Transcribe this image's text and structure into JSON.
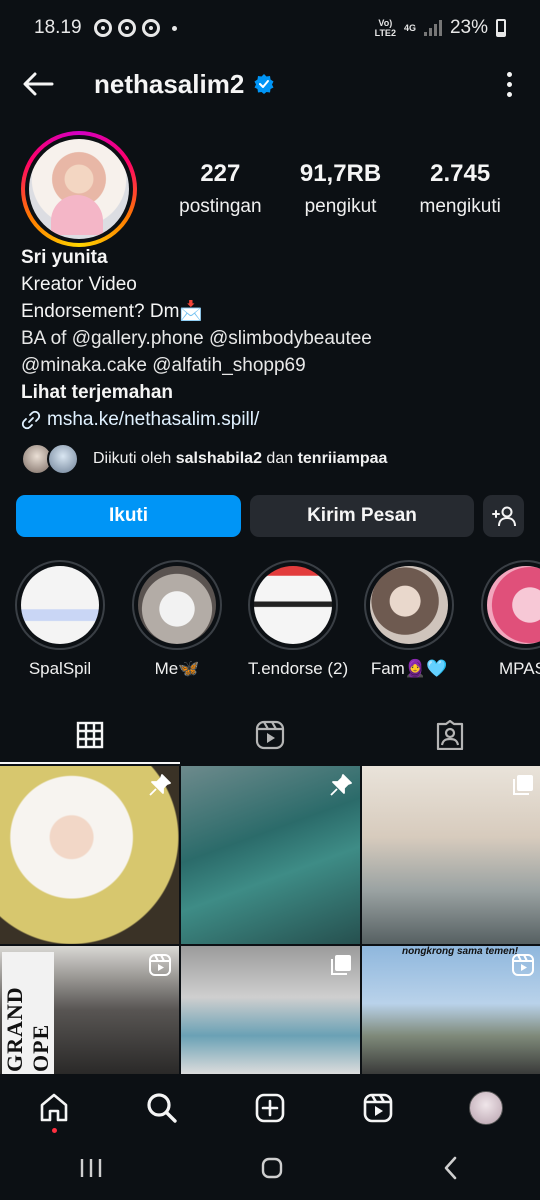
{
  "status_bar": {
    "time": "18.19",
    "network_top": "Vo)",
    "network_bottom": "LTE2",
    "network_type": "4G",
    "battery": "23%",
    "icons": [
      "chrome-icon",
      "chrome-icon",
      "chrome-icon",
      "signal-icon",
      "battery-icon"
    ]
  },
  "header": {
    "username": "nethasalim2",
    "verified": true,
    "icons": [
      "back-arrow-icon",
      "verified-badge-icon",
      "more-options-icon"
    ]
  },
  "profile": {
    "stats": [
      {
        "value": "227",
        "label": "postingan"
      },
      {
        "value": "91,7RB",
        "label": "pengikut"
      },
      {
        "value": "2.745",
        "label": "mengikuti"
      }
    ],
    "bio": {
      "name": "Sri yunita",
      "line1": "Kreator Video",
      "line2": "Endorsement? Dm📩",
      "line3": "BA of  @gallery.phone @slimbodybeautee",
      "line4": "@minaka.cake  @alfatih_shopp69",
      "translate": "Lihat terjemahan",
      "link": "msha.ke/nethasalim.spill/"
    },
    "followed_by": {
      "prefix": "Diikuti oleh ",
      "user1": "salshabila2",
      "middle": " dan ",
      "user2": "tenriiampaa"
    }
  },
  "actions": {
    "follow": "Ikuti",
    "message": "Kirim Pesan"
  },
  "highlights": [
    {
      "label": "SpalSpil"
    },
    {
      "label": "Me🦋"
    },
    {
      "label": "T.endorse (2)"
    },
    {
      "label": "Fam🧕🩵"
    },
    {
      "label": "MPAS"
    }
  ],
  "tabs": [
    "grid-icon",
    "reels-icon",
    "tagged-icon"
  ],
  "grid": {
    "overlay_texts": {
      "grand": "GRAND OPE",
      "caption": "nongkrong sama temen!"
    }
  },
  "bottom_nav": [
    "home-icon",
    "search-icon",
    "create-icon",
    "reels-icon",
    "profile-avatar"
  ],
  "system_nav": [
    "recents-icon",
    "home-button-icon",
    "back-icon"
  ]
}
